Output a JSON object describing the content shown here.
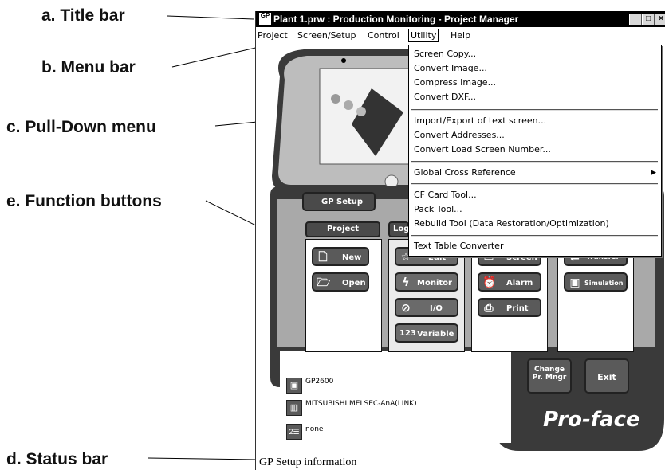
{
  "callouts": {
    "a": "a. Title bar",
    "b": "b. Menu bar",
    "c": "c. Pull-Down menu",
    "e": "e. Function buttons",
    "d": "d. Status bar"
  },
  "window": {
    "title": "Plant 1.prw : Production Monitoring - Project Manager",
    "app_icon_text": "GP",
    "controls": {
      "minimize": "_",
      "maximize": "□",
      "close": "×"
    }
  },
  "menubar": {
    "items": [
      "Project",
      "Screen/Setup",
      "Control",
      "Utility",
      "Help"
    ],
    "active": "Utility"
  },
  "utility_menu": {
    "groups": [
      [
        "Screen Copy...",
        "Convert Image...",
        "Compress Image...",
        "Convert DXF..."
      ],
      [
        "Import/Export of text screen...",
        "Convert Addresses...",
        "Convert Load Screen Number..."
      ],
      [
        "Global Cross Reference"
      ],
      [
        "CF Card Tool...",
        "Pack Tool...",
        "Rebuild Tool (Data Restoration/Optimization)"
      ],
      [
        "Text Table Converter"
      ]
    ],
    "submenu_item": "Global Cross Reference"
  },
  "panel": {
    "gp_setup": "GP Setup",
    "columns": {
      "project": "Project",
      "logic": "Log"
    },
    "buttons": {
      "new": "New",
      "open": "Open",
      "edit": "Edit",
      "monitor": "Monitor",
      "io": "I/O",
      "variable": "Variable",
      "screen": "Screen",
      "alarm": "Alarm",
      "print": "Print",
      "transfer": "Transfer",
      "simulation": "Simulation",
      "change_pr_mngr_1": "Change",
      "change_pr_mngr_2": "Pr. Mngr",
      "exit": "Exit"
    },
    "status_info": {
      "model": "GP2600",
      "plc": "MITSUBISHI MELSEC-AnA(LINK)",
      "extra": "none"
    },
    "brand": "Pro-face"
  },
  "statusbar": {
    "text": "GP Setup information"
  },
  "colors": {
    "panel_dark": "#3a3a3a",
    "panel_light": "#b8b8b8",
    "button": "#5a5a5a"
  }
}
